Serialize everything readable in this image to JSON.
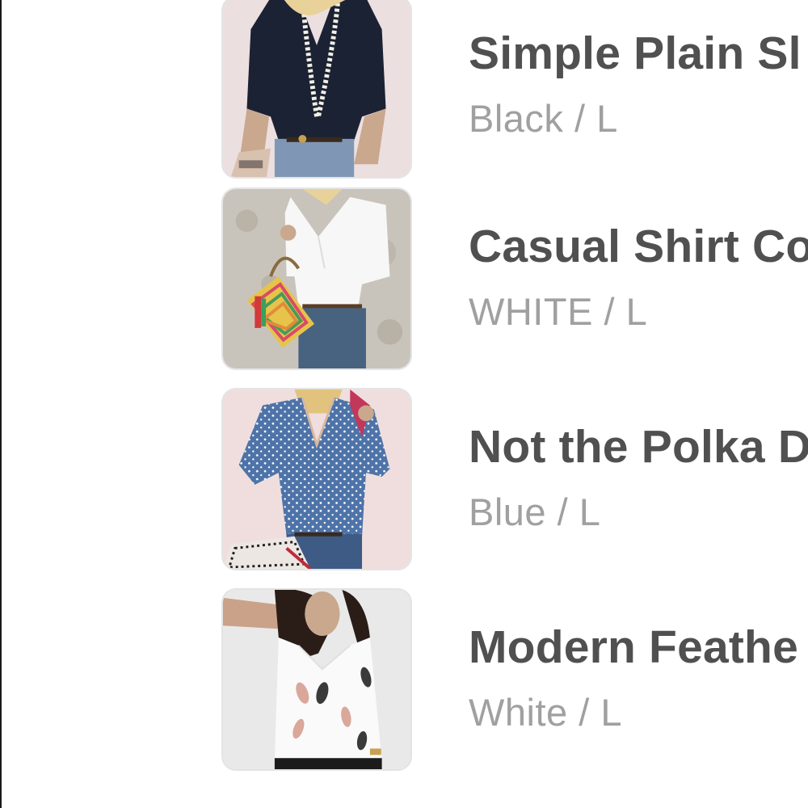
{
  "cart": {
    "items": [
      {
        "title": "Simple Plain Sl",
        "variant": "Black / L",
        "image": "black-v-neck-blouse-with-pearl-necklace"
      },
      {
        "title": "Casual Shirt Co",
        "variant": "WHITE / L",
        "image": "white-shirt-with-zigzag-tote-bag"
      },
      {
        "title": "Not the Polka D",
        "variant": "Blue / L",
        "image": "blue-polka-dot-blouse"
      },
      {
        "title": "Modern Feathe",
        "variant": "White / L",
        "image": "white-feather-print-camisole"
      }
    ]
  },
  "colors": {
    "title": "#505050",
    "variant": "#a0a0a0",
    "thumb_border": "#e4e4e4"
  }
}
